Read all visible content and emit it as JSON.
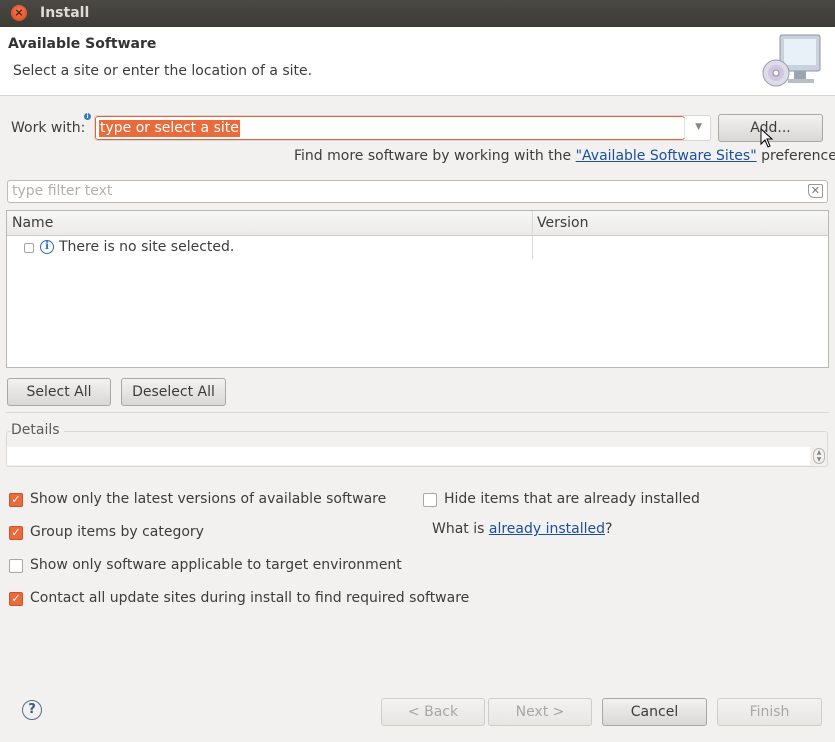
{
  "window": {
    "title": "Install"
  },
  "header": {
    "title": "Available Software",
    "description": "Select a site or enter the location of a site.",
    "icon": "install-software-monitor-cd-icon"
  },
  "work_with": {
    "label": "Work with:",
    "value": "type or select a site",
    "add_button": "Add...",
    "find_more_prefix": "Find more software by working with the ",
    "find_more_link": "\"Available Software Sites\"",
    "find_more_suffix": " preferences."
  },
  "filter": {
    "placeholder": "type filter text"
  },
  "table": {
    "columns": [
      "Name",
      "Version"
    ],
    "rows": [
      {
        "name": "There is no site selected.",
        "version": "",
        "checked": false
      }
    ]
  },
  "selection_buttons": {
    "select_all": "Select All",
    "deselect_all": "Deselect All"
  },
  "details": {
    "label": "Details",
    "text": ""
  },
  "options": {
    "latest_versions": {
      "label": "Show only the latest versions of available software",
      "checked": true
    },
    "group_by_category": {
      "label": "Group items by category",
      "checked": true
    },
    "target_env": {
      "label": "Show only software applicable to target environment",
      "checked": false
    },
    "contact_sites": {
      "label": "Contact all update sites during install to find required software",
      "checked": true
    },
    "hide_installed": {
      "label": "Hide items that are already installed",
      "checked": false
    },
    "what_is_prefix": "What is ",
    "what_is_link": "already installed",
    "what_is_suffix": "?"
  },
  "footer": {
    "back": "< Back",
    "next": "Next >",
    "cancel": "Cancel",
    "finish": "Finish"
  },
  "colors": {
    "accent": "#e96a3b",
    "link": "#1b4f9a",
    "titlebar": "#3c3b37"
  }
}
